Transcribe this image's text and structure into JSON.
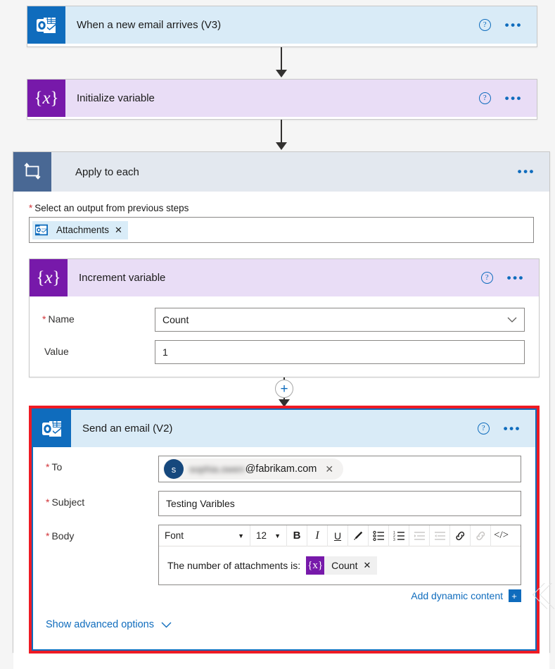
{
  "flow": {
    "trigger": {
      "title": "When a new email arrives (V3)",
      "icon": "outlook-icon",
      "help_label": "?",
      "more_label": "•••",
      "header_color": "#d9ebf7",
      "tile_color": "#0f6cbd"
    },
    "init_variable": {
      "title": "Initialize variable",
      "icon": "variable-icon",
      "help_label": "?",
      "more_label": "•••",
      "header_color": "#e9ddf6",
      "tile_color": "#7719aa"
    },
    "apply_to_each": {
      "title": "Apply to each",
      "icon": "loop-icon",
      "more_label": "•••",
      "header_color": "#e3e8ef",
      "tile_color": "#496894",
      "output_field": {
        "required_mark": "*",
        "label": "Select an output from previous steps",
        "token": {
          "text": "Attachments",
          "remove_label": "✕",
          "icon": "outlook-icon"
        }
      },
      "increment_variable": {
        "title": "Increment variable",
        "icon": "variable-icon",
        "help_label": "?",
        "more_label": "•••",
        "header_color": "#e9ddf6",
        "tile_color": "#7719aa",
        "fields": [
          {
            "required_mark": "*",
            "label": "Name",
            "value": "Count",
            "type": "dropdown",
            "caret": "⌄"
          },
          {
            "required_mark": "",
            "label": "Value",
            "value": "1",
            "type": "text",
            "caret": ""
          }
        ]
      },
      "add_step_button": "+",
      "send_email": {
        "title": "Send an email (V2)",
        "icon": "outlook-icon",
        "help_label": "?",
        "more_label": "•••",
        "header_color": "#d9ebf7",
        "tile_color": "#0f6cbd",
        "highlight_color": "#ee1b24",
        "selection_color": "#0f6cbd",
        "to_field": {
          "required_mark": "*",
          "label": "To",
          "avatar_initial": "s",
          "recipient_blurred": "sophia.owen",
          "recipient_domain": "@fabrikam.com",
          "remove_label": "✕"
        },
        "subject_field": {
          "required_mark": "*",
          "label": "Subject",
          "value": "Testing Varibles"
        },
        "body_field": {
          "required_mark": "*",
          "label": "Body",
          "toolbar": {
            "font_name": "Font",
            "font_name_caret": "▼",
            "font_size": "12",
            "font_size_caret": "▼",
            "buttons": [
              {
                "name": "bold-icon",
                "glyph": "B",
                "disabled": false
              },
              {
                "name": "italic-icon",
                "glyph": "I",
                "disabled": false
              },
              {
                "name": "underline-icon",
                "glyph": "U",
                "disabled": false
              },
              {
                "name": "highlight-pen-icon",
                "glyph": "✎",
                "disabled": false
              },
              {
                "name": "bulleted-list-icon",
                "glyph": "☰",
                "disabled": false
              },
              {
                "name": "numbered-list-icon",
                "glyph": "☲",
                "disabled": false
              },
              {
                "name": "increase-indent-icon",
                "glyph": "⇥",
                "disabled": true
              },
              {
                "name": "decrease-indent-icon",
                "glyph": "⇤",
                "disabled": true
              },
              {
                "name": "insert-link-icon",
                "glyph": "🔗",
                "disabled": false
              },
              {
                "name": "remove-link-icon",
                "glyph": "🔗",
                "disabled": true
              },
              {
                "name": "code-view-icon",
                "glyph": "</>",
                "disabled": false
              }
            ]
          },
          "content_text": "The number of attachments is:",
          "content_token": {
            "text": "Count",
            "remove_label": "✕",
            "icon": "variable-icon",
            "icon_glyph": "{x}"
          }
        },
        "add_dynamic_content": {
          "label": "Add dynamic content",
          "plus_label": "+"
        },
        "advanced_options": {
          "label": "Show advanced options",
          "chevron": "⌄"
        }
      }
    }
  }
}
